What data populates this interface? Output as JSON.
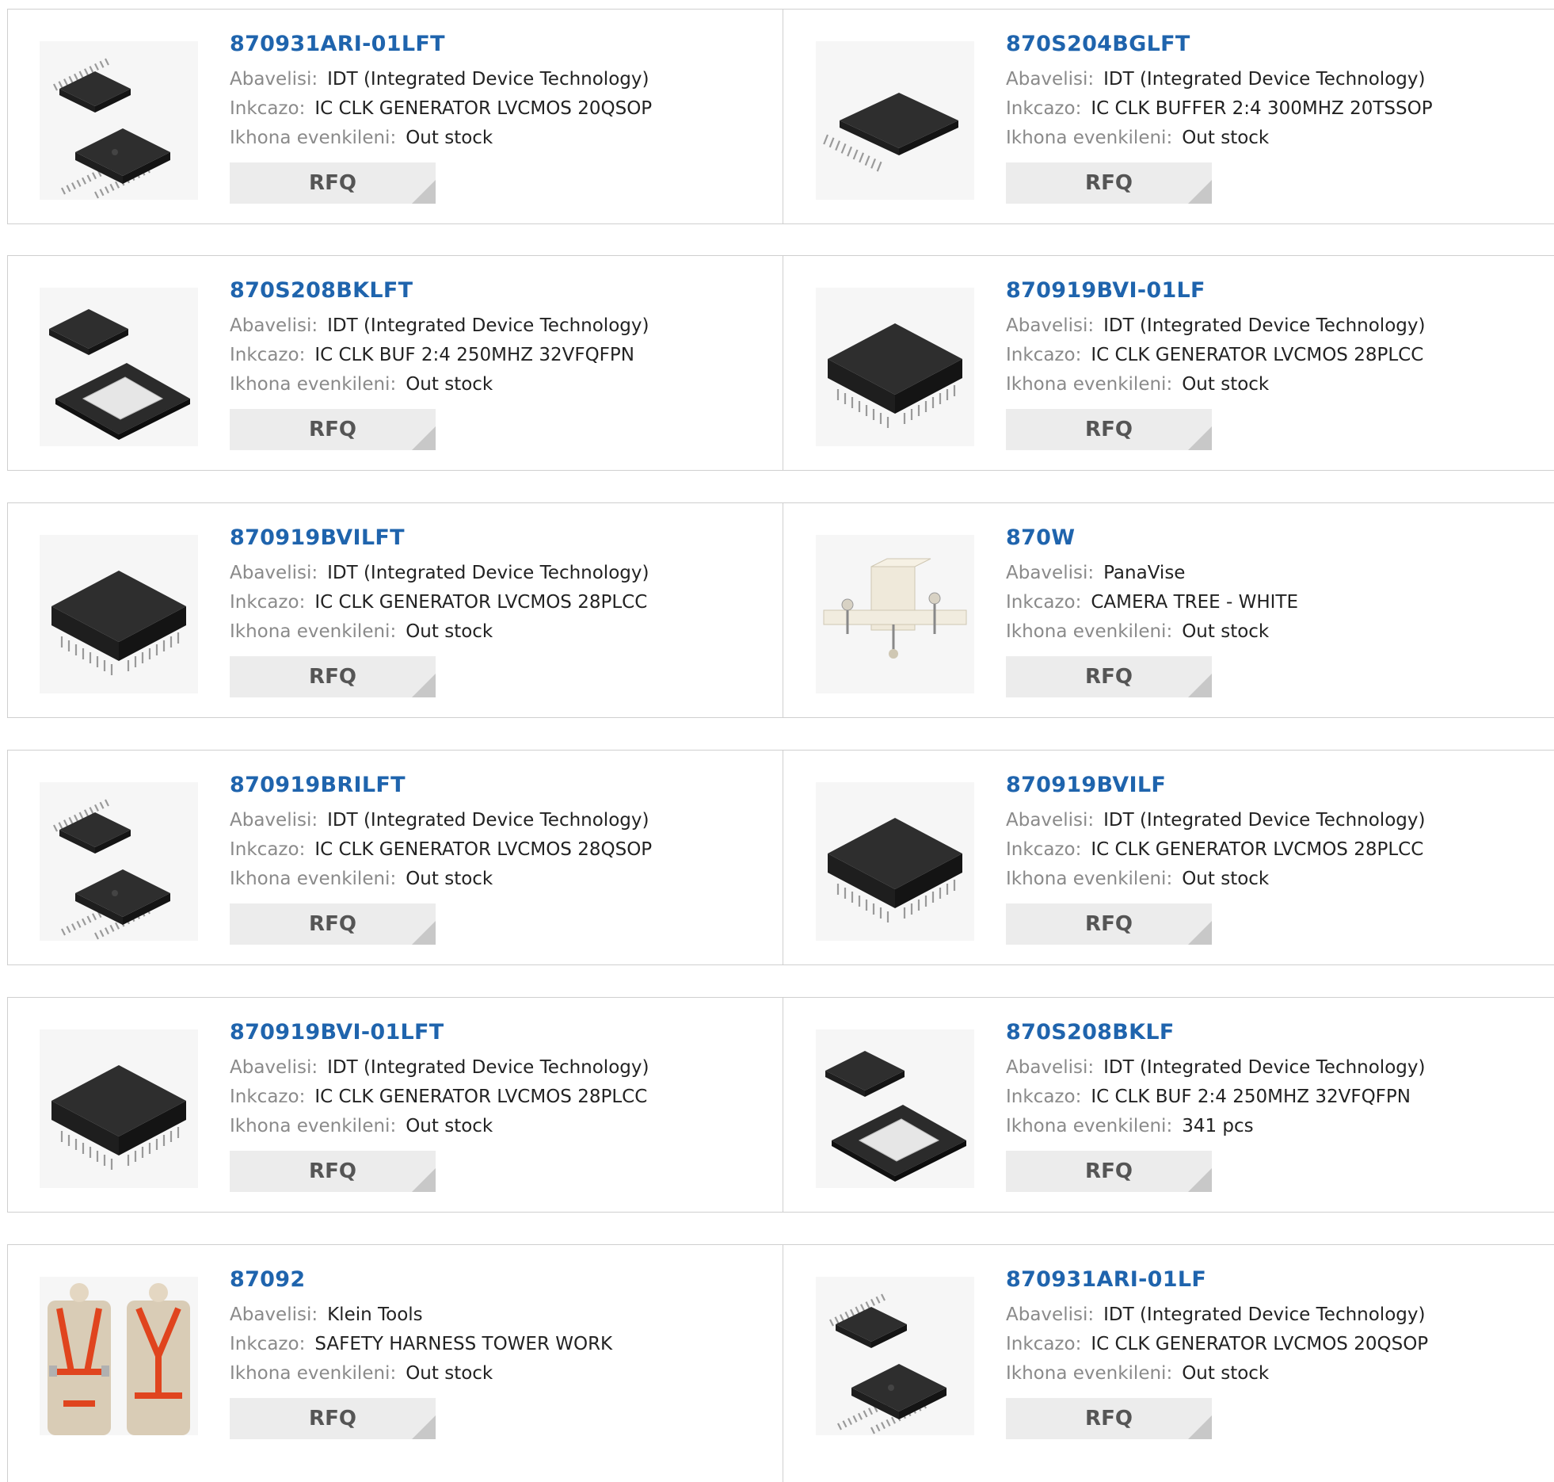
{
  "labels": {
    "manufacturer": "Abavelisi:",
    "description": "Inkcazo:",
    "stock": "Ikhona evenkileni:",
    "rfq": "RFQ"
  },
  "products": [
    {
      "part": "870931ARI-01LFT",
      "manufacturer": "IDT (Integrated Device Technology)",
      "description": "IC CLK GENERATOR LVCMOS 20QSOP",
      "stock": "Out stock",
      "image": "qsop-chip-icon"
    },
    {
      "part": "870S204BGLFT",
      "manufacturer": "IDT (Integrated Device Technology)",
      "description": "IC CLK BUFFER 2:4 300MHZ 20TSSOP",
      "stock": "Out stock",
      "image": "tssop-chip-icon"
    },
    {
      "part": "870S208BKLFT",
      "manufacturer": "IDT (Integrated Device Technology)",
      "description": "IC CLK BUF 2:4 250MHZ 32VFQFPN",
      "stock": "Out stock",
      "image": "qfn-chip-icon"
    },
    {
      "part": "870919BVI-01LF",
      "manufacturer": "IDT (Integrated Device Technology)",
      "description": "IC CLK GENERATOR LVCMOS 28PLCC",
      "stock": "Out stock",
      "image": "plcc-chip-icon"
    },
    {
      "part": "870919BVILFT",
      "manufacturer": "IDT (Integrated Device Technology)",
      "description": "IC CLK GENERATOR LVCMOS 28PLCC",
      "stock": "Out stock",
      "image": "plcc-chip-icon"
    },
    {
      "part": "870W",
      "manufacturer": "PanaVise",
      "description": "CAMERA TREE - WHITE",
      "stock": "Out stock",
      "image": "camera-tree-icon"
    },
    {
      "part": "870919BRILFT",
      "manufacturer": "IDT (Integrated Device Technology)",
      "description": "IC CLK GENERATOR LVCMOS 28QSOP",
      "stock": "Out stock",
      "image": "qsop-chip-icon"
    },
    {
      "part": "870919BVILF",
      "manufacturer": "IDT (Integrated Device Technology)",
      "description": "IC CLK GENERATOR LVCMOS 28PLCC",
      "stock": "Out stock",
      "image": "plcc-chip-icon"
    },
    {
      "part": "870919BVI-01LFT",
      "manufacturer": "IDT (Integrated Device Technology)",
      "description": "IC CLK GENERATOR LVCMOS 28PLCC",
      "stock": "Out stock",
      "image": "plcc-chip-icon"
    },
    {
      "part": "870S208BKLF",
      "manufacturer": "IDT (Integrated Device Technology)",
      "description": "IC CLK BUF 2:4 250MHZ 32VFQFPN",
      "stock": "341 pcs",
      "image": "qfn-chip-icon"
    },
    {
      "part": "87092",
      "manufacturer": "Klein Tools",
      "description": "SAFETY HARNESS TOWER WORK",
      "stock": "Out stock",
      "image": "safety-harness-icon"
    },
    {
      "part": "870931ARI-01LF",
      "manufacturer": "IDT (Integrated Device Technology)",
      "description": "IC CLK GENERATOR LVCMOS 20QSOP",
      "stock": "Out stock",
      "image": "qsop-chip-icon"
    }
  ]
}
